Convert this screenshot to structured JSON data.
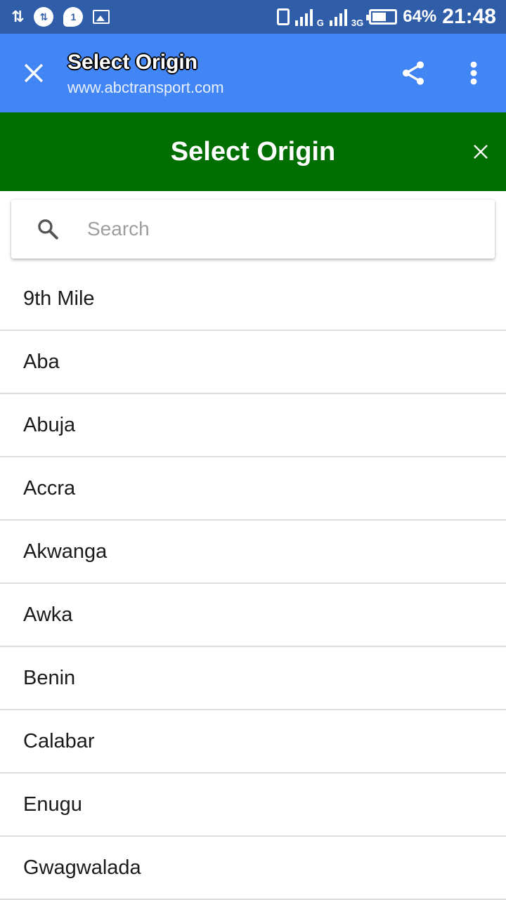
{
  "status_bar": {
    "data_icon": "⇅",
    "battery_percent": "64%",
    "battery_level": 0.64,
    "time": "21:48",
    "net_1": "G",
    "net_2": "3G"
  },
  "app_bar": {
    "title": "Select Origin",
    "url": "www.abctransport.com",
    "icons": [
      "close-icon",
      "share-icon",
      "more-vert-icon"
    ]
  },
  "dialog_header": {
    "title": "Select Origin",
    "close_icon": "close-icon"
  },
  "search": {
    "placeholder": "Search",
    "value": ""
  },
  "origins": [
    "9th Mile",
    "Aba",
    "Abuja",
    "Accra",
    "Akwanga",
    "Awka",
    "Benin",
    "Calabar",
    "Enugu",
    "Gwagwalada"
  ],
  "colors": {
    "status_bar": "#2f5da8",
    "app_bar": "#4285f4",
    "header": "#006e00"
  }
}
